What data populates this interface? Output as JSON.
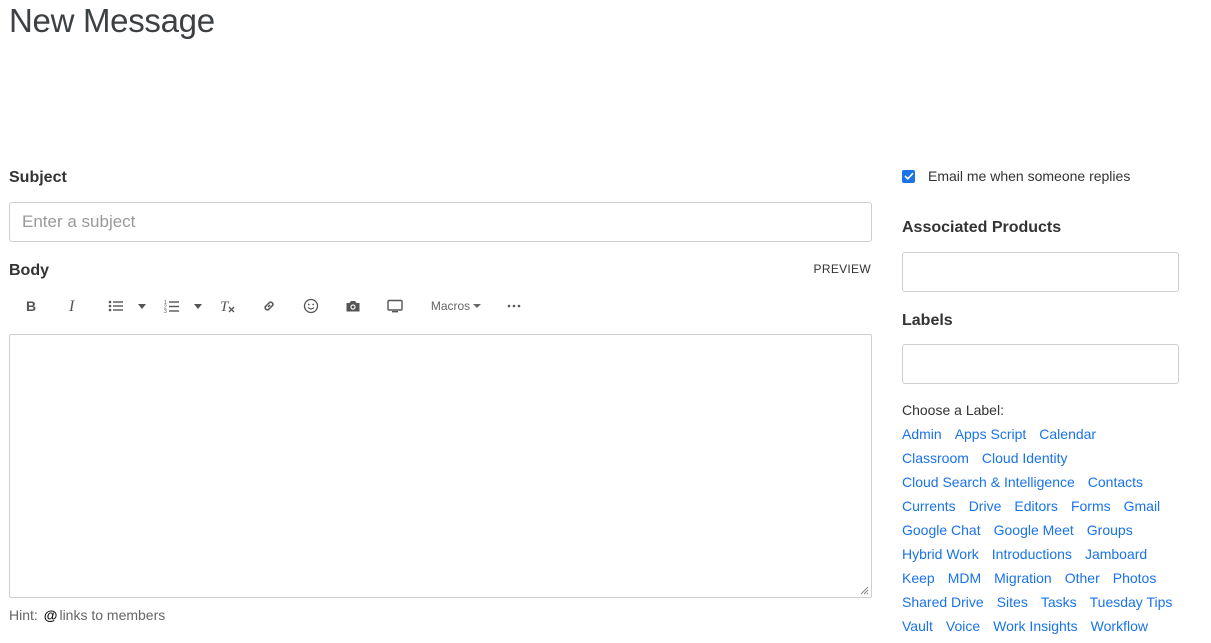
{
  "page": {
    "title": "New Message"
  },
  "subject": {
    "label": "Subject",
    "placeholder": "Enter a subject",
    "value": ""
  },
  "body": {
    "label": "Body",
    "preview_label": "PREVIEW",
    "toolbar": {
      "bold": "bold-icon",
      "italic": "italic-icon",
      "bullet_list": "bulleted-list-icon",
      "numbered_list": "numbered-list-icon",
      "clear_format": "clear-formatting-icon",
      "link": "link-icon",
      "emoji": "emoji-icon",
      "photo": "camera-icon",
      "video": "monitor-icon",
      "macros_label": "Macros",
      "more": "more-icon"
    },
    "value": ""
  },
  "hint": {
    "prefix": "Hint:",
    "at": "@",
    "text": "links to members"
  },
  "sidebar": {
    "email_replies_label": "Email me when someone replies",
    "email_replies_checked": true,
    "associated_products_label": "Associated Products",
    "labels_label": "Labels",
    "choose_label_text": "Choose a Label:",
    "label_rows": [
      [
        "Admin",
        "Apps Script",
        "Calendar"
      ],
      [
        "Classroom",
        "Cloud Identity"
      ],
      [
        "Cloud Search & Intelligence",
        "Contacts"
      ],
      [
        "Currents",
        "Drive",
        "Editors",
        "Forms",
        "Gmail"
      ],
      [
        "Google Chat",
        "Google Meet",
        "Groups"
      ],
      [
        "Hybrid Work",
        "Introductions",
        "Jamboard"
      ],
      [
        "Keep",
        "MDM",
        "Migration",
        "Other",
        "Photos"
      ],
      [
        "Shared Drive",
        "Sites",
        "Tasks",
        "Tuesday Tips"
      ],
      [
        "Vault",
        "Voice",
        "Work Insights",
        "Workflow"
      ]
    ]
  },
  "colors": {
    "link": "#1a73e8",
    "checkbox": "#1a73e8",
    "border": "#cfcfcf"
  }
}
